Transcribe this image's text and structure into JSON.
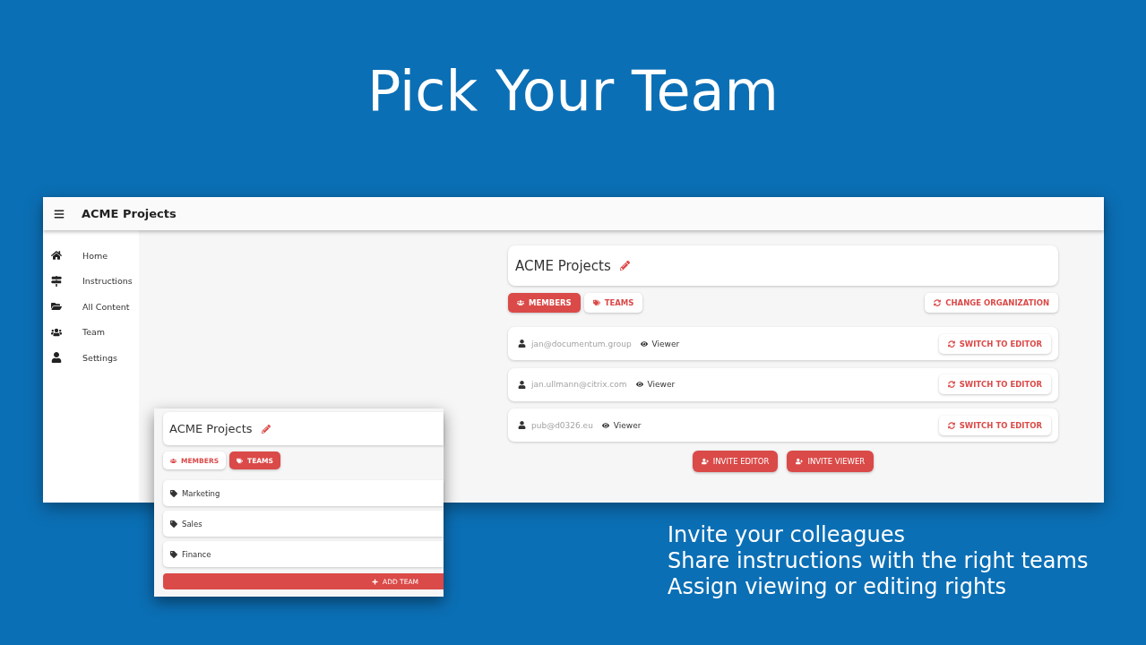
{
  "headline": "Pick Your Team",
  "app": {
    "app_bar": {
      "title": "ACME Projects"
    },
    "sidebar": {
      "items": [
        {
          "label": "Home"
        },
        {
          "label": "Instructions"
        },
        {
          "label": "All Content"
        },
        {
          "label": "Team"
        },
        {
          "label": "Settings"
        }
      ]
    },
    "organization": {
      "name": "ACME Projects"
    },
    "tabs": [
      {
        "label": "MEMBERS",
        "selected": true
      },
      {
        "label": "TEAMS",
        "selected": false
      }
    ],
    "change_button": "CHANGE ORGANIZATION",
    "members": [
      {
        "email": "jan@documentum.group",
        "role": "Viewer",
        "action": "SWITCH TO EDITOR"
      },
      {
        "email": "jan.ullmann@citrix.com",
        "role": "Viewer",
        "action": "SWITCH TO EDITOR"
      },
      {
        "email": "pub@d0326.eu",
        "role": "Viewer",
        "action": "SWITCH TO EDITOR"
      }
    ],
    "invite_buttons": [
      "INVITE EDITOR",
      "INVITE VIEWER"
    ]
  },
  "teams_panel": {
    "organization": {
      "name": "ACME Projects"
    },
    "tabs": [
      {
        "label": "MEMBERS",
        "selected": false
      },
      {
        "label": "TEAMS",
        "selected": true
      }
    ],
    "teams": [
      "Marketing",
      "Sales",
      "Finance"
    ],
    "add_button": "ADD TEAM"
  },
  "bullets": [
    "Invite your colleagues",
    "Share instructions with the right teams",
    "Assign viewing or editing rights"
  ]
}
